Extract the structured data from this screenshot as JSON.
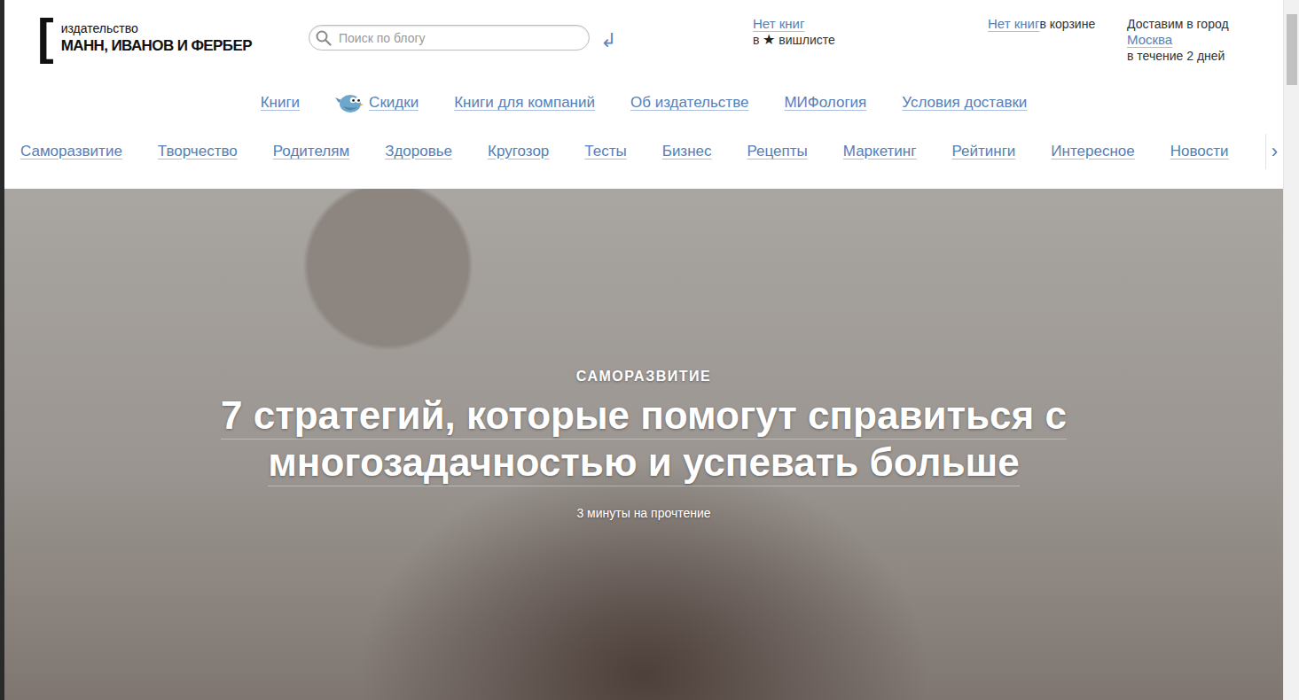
{
  "logo": {
    "bracket": "[",
    "line1": "издательство",
    "line2": "МАНН, ИВАНОВ И ФЕРБЕР"
  },
  "search": {
    "placeholder": "Поиск по блогу",
    "submit": "↲"
  },
  "wishlist": {
    "link": "Нет книг",
    "prefix": "в",
    "star": "★",
    "label": "вишлисте"
  },
  "cart": {
    "link": "Нет книг",
    "label": "в корзине"
  },
  "delivery": {
    "line1": "Доставим в город",
    "city": "Москва",
    "line3": "в течение 2 дней"
  },
  "mainNav": [
    {
      "label": "Книги",
      "kind": "plain"
    },
    {
      "label": "Скидки",
      "kind": "with-icon"
    },
    {
      "label": "Книги для компаний",
      "kind": "plain"
    },
    {
      "label": "Об издательстве",
      "kind": "plain"
    },
    {
      "label": "МИФология",
      "kind": "plain"
    },
    {
      "label": "Условия доставки",
      "kind": "plain"
    }
  ],
  "categories": [
    "Саморазвитие",
    "Творчество",
    "Родителям",
    "Здоровье",
    "Кругозор",
    "Тесты",
    "Бизнес",
    "Рецепты",
    "Маркетинг",
    "Рейтинги",
    "Интересное",
    "Новости"
  ],
  "categoriesNext": "›",
  "hero": {
    "category": "САМОРАЗВИТИЕ",
    "titleLines": [
      "7 стратегий, которые помогут справиться с",
      "многозадачностью и успевать больше"
    ],
    "readTime": "3 минуты на прочтение"
  }
}
